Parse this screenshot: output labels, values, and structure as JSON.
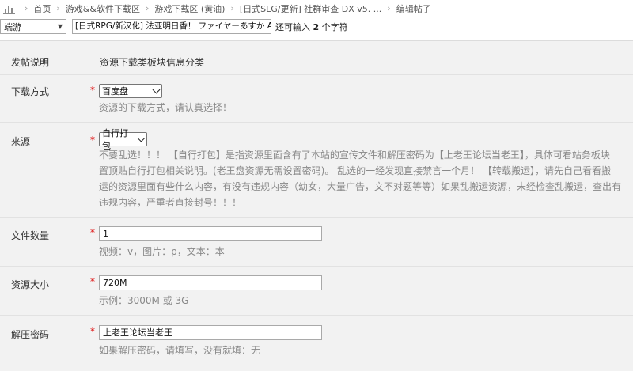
{
  "breadcrumb": {
    "items": [
      "首页",
      "游戏&&软件下载区",
      "游戏下载区 (黄油)",
      "[日式SLG/更新] 社群审查 DX v5. ...",
      "编辑帖子"
    ]
  },
  "title_row": {
    "type_value": "端游",
    "title_value": "[日式RPG/新汉化] 法亚明日香！ ファイヤーあすか AI汉",
    "hint_prefix": "还可输入",
    "hint_count": "2",
    "hint_suffix": "个字符"
  },
  "form": {
    "intro": {
      "label": "发帖说明",
      "value": "资源下载类板块信息分类"
    },
    "download_method": {
      "label": "下载方式",
      "required": "*",
      "selected": "百度盘",
      "help": "资源的下载方式，请认真选择！"
    },
    "source": {
      "label": "来源",
      "required": "*",
      "selected": "自行打包",
      "help_lines": [
        "不要乱选！！！ 【自行打包】是指资源里面含有了本站的宣传文件和解压密码为【上老王论坛当老王】，具体可看站务板块",
        "置顶贴自行打包相关说明。(老王盘资源无需设置密码)。 乱选的一经发现直接禁言一个月！ 【转载搬运】，请先自己看看搬",
        "运的资源里面有些什么内容，有没有违规内容（幼女，大量广告，文不对题等等）如果乱搬运资源，未经检查乱搬运，查出有",
        "违规内容，严重者直接封号！！！"
      ]
    },
    "file_count": {
      "label": "文件数量",
      "required": "*",
      "value": "1",
      "help": "视频：v，图片：p，文本：本"
    },
    "resource_size": {
      "label": "资源大小",
      "required": "*",
      "value": "720M",
      "help": "示例：3000M 或 3G"
    },
    "unzip_password": {
      "label": "解压密码",
      "required": "*",
      "value": "上老王论坛当老王",
      "help": "如果解压密码，请填写，没有就填：无"
    }
  }
}
